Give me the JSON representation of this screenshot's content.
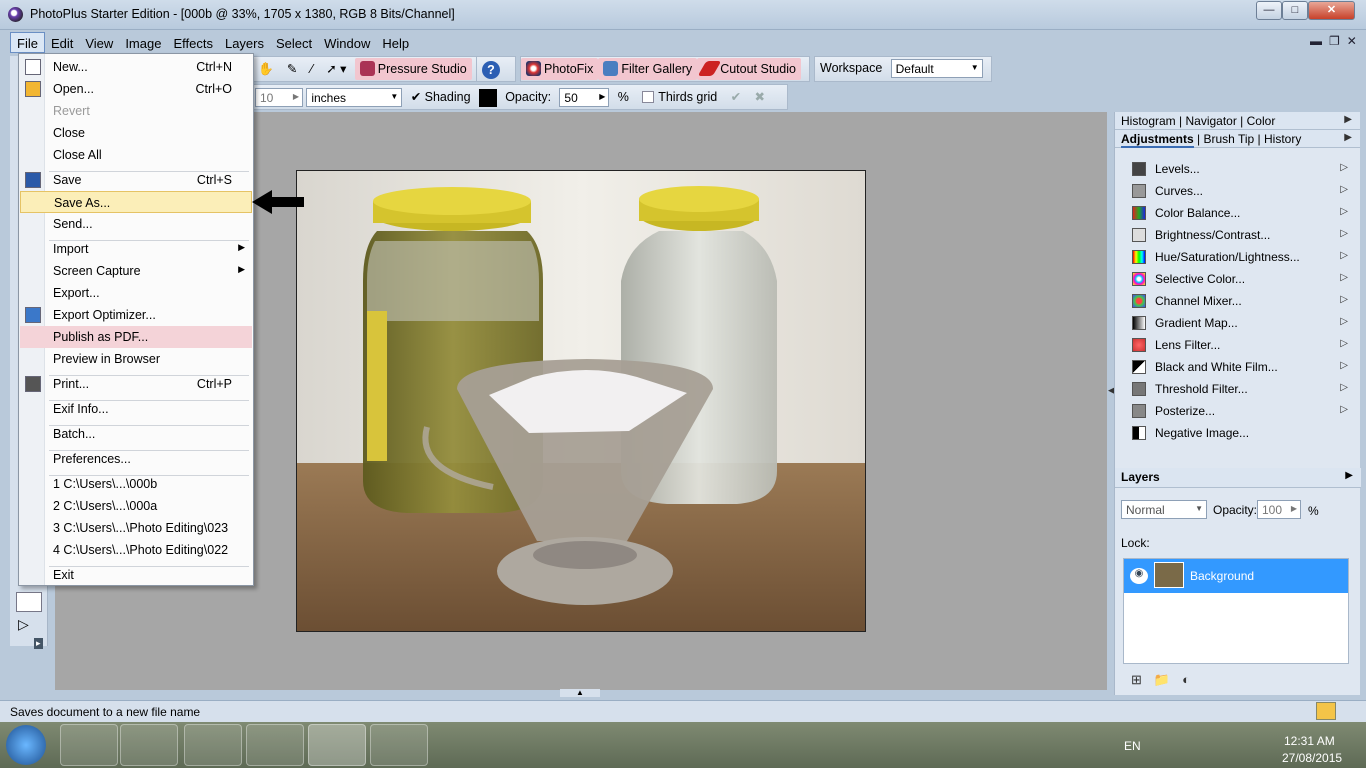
{
  "window": {
    "title": "PhotoPlus Starter Edition - [000b @ 33%, 1705 x 1380, RGB 8 Bits/Channel]"
  },
  "menubar": [
    "File",
    "Edit",
    "View",
    "Image",
    "Effects",
    "Layers",
    "Select",
    "Window",
    "Help"
  ],
  "toolbar": {
    "pressure_studio": "Pressure Studio",
    "photofix": "PhotoFix",
    "filter_gallery": "Filter Gallery",
    "cutout_studio": "Cutout Studio",
    "workspace_label": "Workspace",
    "workspace_value": "Default"
  },
  "context_toolbar": {
    "size_value": "10",
    "units": "inches",
    "shading_label": "Shading",
    "opacity_label": "Opacity:",
    "opacity_value": "50",
    "percent": "%",
    "thirds_grid_label": "Thirds grid"
  },
  "file_menu": {
    "items": [
      {
        "label": "New...",
        "shortcut": "Ctrl+N"
      },
      {
        "label": "Open...",
        "shortcut": "Ctrl+O"
      },
      {
        "label": "Revert",
        "shortcut": ""
      },
      {
        "label": "Close",
        "shortcut": ""
      },
      {
        "label": "Close All",
        "shortcut": ""
      },
      {
        "label": "Save",
        "shortcut": "Ctrl+S"
      },
      {
        "label": "Save As...",
        "shortcut": ""
      },
      {
        "label": "Send...",
        "shortcut": ""
      },
      {
        "label": "Import",
        "shortcut": ""
      },
      {
        "label": "Screen Capture",
        "shortcut": ""
      },
      {
        "label": "Export...",
        "shortcut": ""
      },
      {
        "label": "Export Optimizer...",
        "shortcut": ""
      },
      {
        "label": "Publish as PDF...",
        "shortcut": ""
      },
      {
        "label": "Preview in Browser",
        "shortcut": ""
      },
      {
        "label": "Print...",
        "shortcut": "Ctrl+P"
      },
      {
        "label": "Exif Info...",
        "shortcut": ""
      },
      {
        "label": "Batch...",
        "shortcut": ""
      },
      {
        "label": "Preferences...",
        "shortcut": ""
      },
      {
        "label": "1 C:\\Users\\...\\000b",
        "shortcut": ""
      },
      {
        "label": "2 C:\\Users\\...\\000a",
        "shortcut": ""
      },
      {
        "label": "3 C:\\Users\\...\\Photo Editing\\023",
        "shortcut": ""
      },
      {
        "label": "4 C:\\Users\\...\\Photo Editing\\022",
        "shortcut": ""
      },
      {
        "label": "Exit",
        "shortcut": ""
      }
    ]
  },
  "right_panel": {
    "tabs_top": [
      "Histogram",
      "Navigator",
      "Color"
    ],
    "tabs_second": [
      "Adjustments",
      "Brush Tip",
      "History"
    ],
    "adjustments": [
      "Levels...",
      "Curves...",
      "Color Balance...",
      "Brightness/Contrast...",
      "Hue/Saturation/Lightness...",
      "Selective Color...",
      "Channel Mixer...",
      "Gradient Map...",
      "Lens Filter...",
      "Black and White Film...",
      "Threshold Filter...",
      "Posterize...",
      "Negative Image..."
    ],
    "layers_title": "Layers",
    "blend_mode": "Normal",
    "opacity_label": "Opacity:",
    "opacity_value": "100",
    "percent": "%",
    "lock_label": "Lock:",
    "layer_name": "Background"
  },
  "status": {
    "text": "Saves document to a new file name"
  },
  "taskbar": {
    "lang": "EN",
    "time": "12:31 AM",
    "date": "27/08/2015"
  },
  "colors": {
    "selection": "#3399ff",
    "menu_highlight": "#fbeeb8",
    "pink_highlight": "#f4d3d8"
  }
}
